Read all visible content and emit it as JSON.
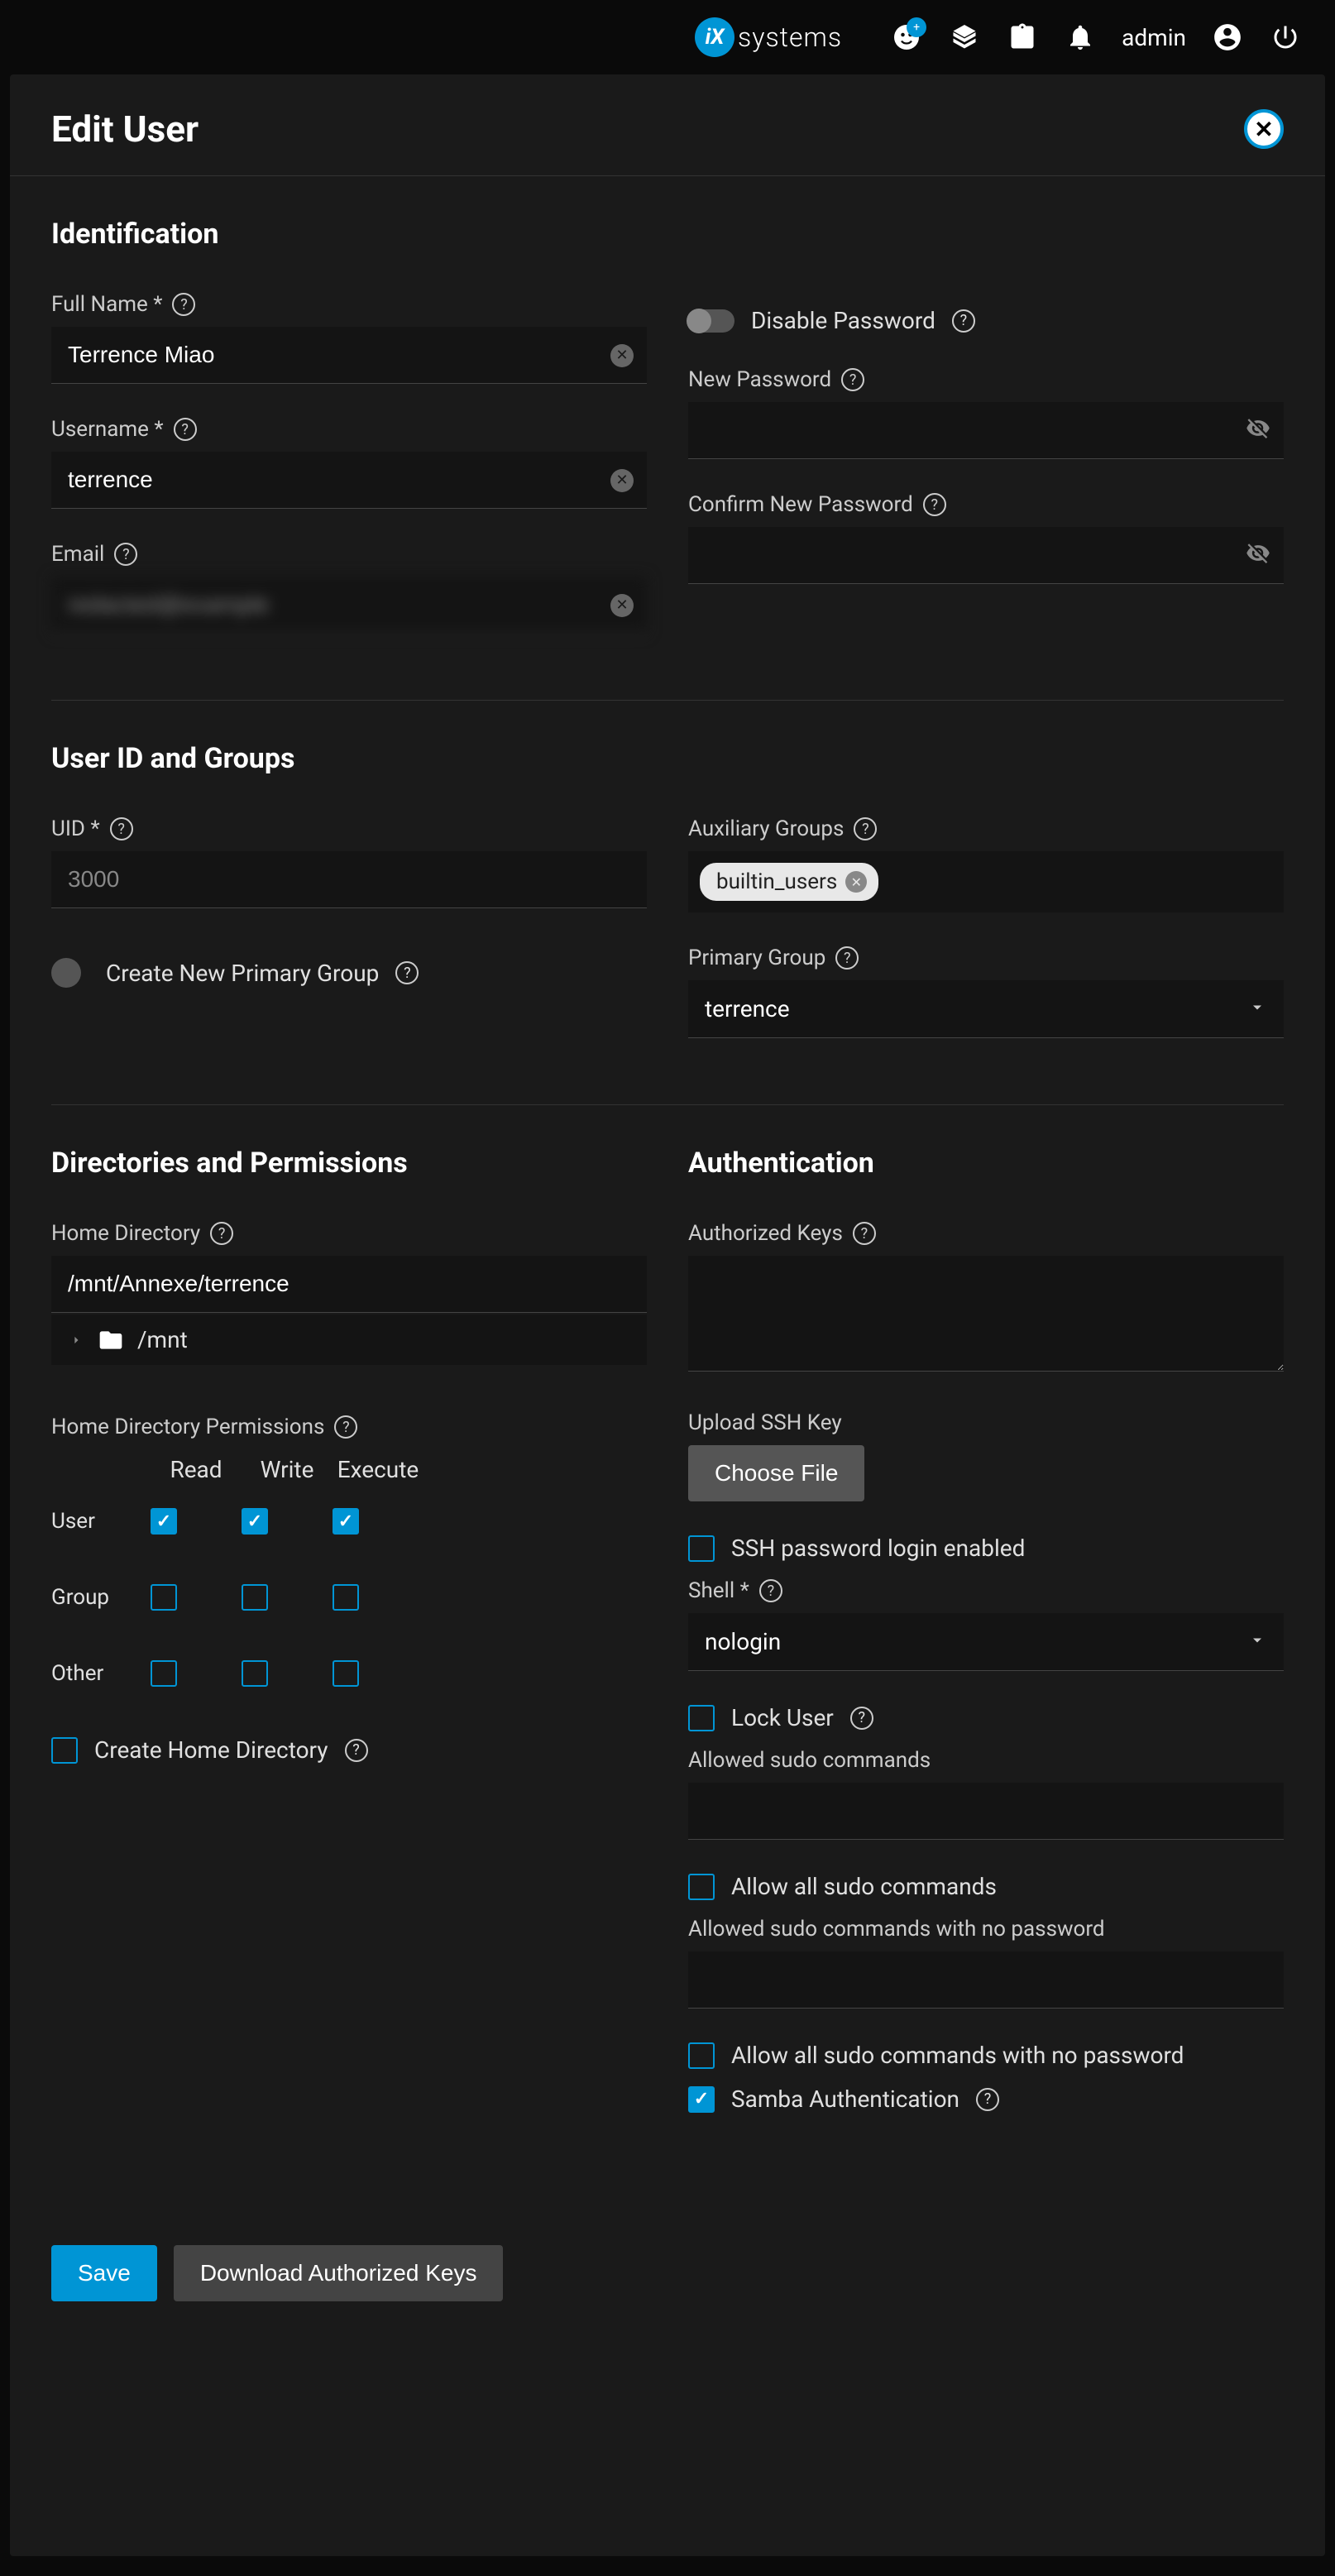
{
  "topbar": {
    "logo_text": "systems",
    "username": "admin"
  },
  "panel": {
    "title": "Edit User"
  },
  "sections": {
    "identification": "Identification",
    "uid_groups": "User ID and Groups",
    "dirs_perms": "Directories and Permissions",
    "auth": "Authentication"
  },
  "fields": {
    "full_name_label": "Full Name *",
    "full_name_value": "Terrence Miao",
    "username_label": "Username *",
    "username_value": "terrence",
    "email_label": "Email",
    "email_value": "redacted@example",
    "disable_password_label": "Disable Password",
    "new_password_label": "New Password",
    "confirm_password_label": "Confirm New Password",
    "uid_label": "UID *",
    "uid_value": "3000",
    "aux_groups_label": "Auxiliary Groups",
    "aux_groups_chip": "builtin_users",
    "create_primary_label": "Create New Primary Group",
    "primary_group_label": "Primary Group",
    "primary_group_value": "terrence",
    "home_dir_label": "Home Directory",
    "home_dir_value": "/mnt/Annexe/terrence",
    "tree_root": "/mnt",
    "home_perms_label": "Home Directory Permissions",
    "perm_read": "Read",
    "perm_write": "Write",
    "perm_exec": "Execute",
    "perm_user": "User",
    "perm_group": "Group",
    "perm_other": "Other",
    "create_home_label": "Create Home Directory",
    "auth_keys_label": "Authorized Keys",
    "upload_ssh_label": "Upload SSH Key",
    "choose_file": "Choose File",
    "ssh_password_label": "SSH password login enabled",
    "shell_label": "Shell *",
    "shell_value": "nologin",
    "lock_user_label": "Lock User",
    "sudo_cmds_label": "Allowed sudo commands",
    "allow_all_sudo_label": "Allow all sudo commands",
    "sudo_nopass_label": "Allowed sudo commands with no password",
    "allow_all_sudo_nopass_label": "Allow all sudo commands with no password",
    "samba_auth_label": "Samba Authentication"
  },
  "buttons": {
    "save": "Save",
    "download_keys": "Download Authorized Keys"
  }
}
